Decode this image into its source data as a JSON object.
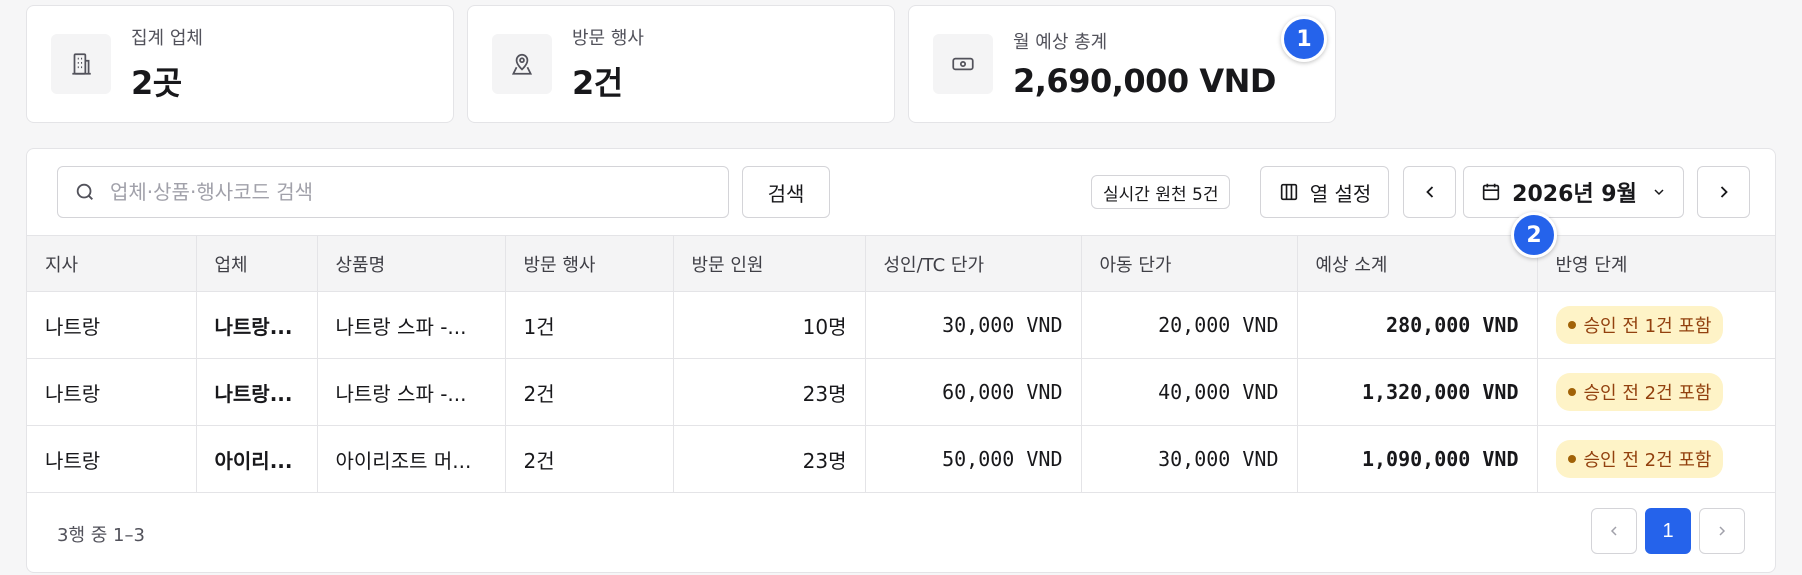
{
  "stats": [
    {
      "label": "집계 업체",
      "value": "2곳",
      "icon": "building-icon"
    },
    {
      "label": "방문 행사",
      "value": "2건",
      "icon": "map-pin-icon"
    },
    {
      "label": "월 예상 총계",
      "value": "2,690,000 VND",
      "icon": "money-icon"
    }
  ],
  "markers": {
    "m1": "1",
    "m2": "2"
  },
  "toolbar": {
    "search_placeholder": "업체·상품·행사코드 검색",
    "search_button": "검색",
    "live_chip": "실시간 원천 5건",
    "columns_button": "열 설정",
    "month_label": "2026년 9월"
  },
  "table": {
    "headers": [
      "지사",
      "업체",
      "상품명",
      "방문 행사",
      "방문 인원",
      "성인/TC 단가",
      "아동 단가",
      "예상 소계",
      "반영 단계"
    ],
    "rows": [
      [
        "나트랑",
        "나트랑...",
        "나트랑 스파 -...",
        "1건",
        "10명",
        "30,000 VND",
        "20,000 VND",
        "280,000 VND",
        "승인 전 1건 포함"
      ],
      [
        "나트랑",
        "나트랑...",
        "나트랑 스파 -...",
        "2건",
        "23명",
        "60,000 VND",
        "40,000 VND",
        "1,320,000 VND",
        "승인 전 2건 포함"
      ],
      [
        "나트랑",
        "아이리...",
        "아이리조트 머...",
        "2건",
        "23명",
        "50,000 VND",
        "30,000 VND",
        "1,090,000 VND",
        "승인 전 2건 포함"
      ]
    ]
  },
  "footer": {
    "summary": "3행 중 1–3",
    "current_page": "1"
  },
  "colors": {
    "accent": "#2563eb",
    "badge_bg": "#fef3c7",
    "badge_text": "#92400e"
  }
}
